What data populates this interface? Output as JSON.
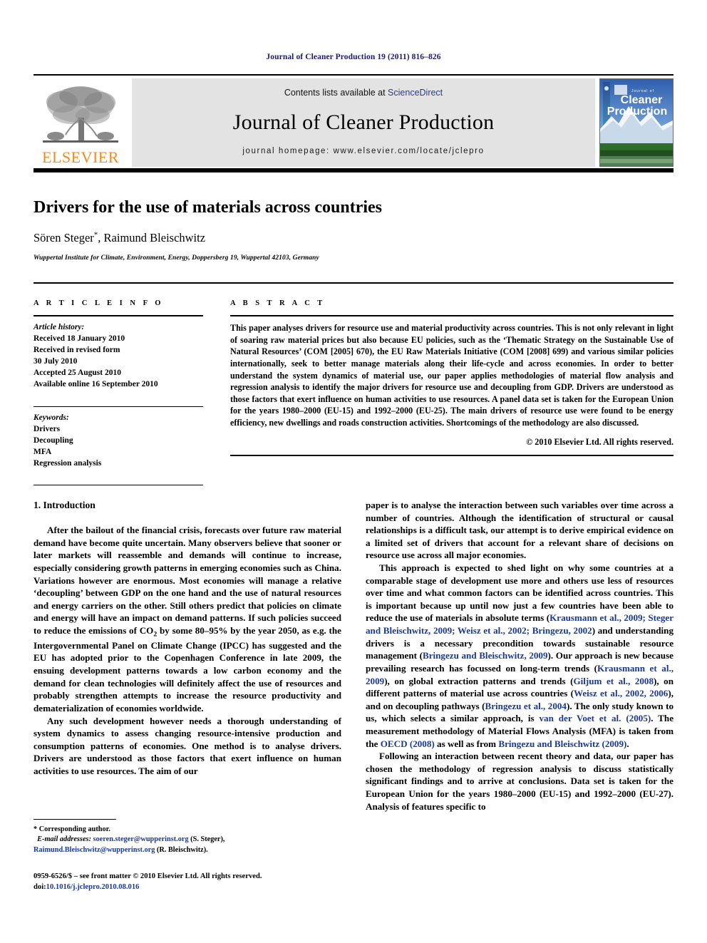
{
  "running_head": "Journal of Cleaner Production 19 (2011) 816–826",
  "masthead": {
    "publisher_name": "ELSEVIER",
    "contents_prefix": "Contents lists available at ",
    "sciencedirect": "ScienceDirect",
    "journal_title": "Journal of Cleaner Production",
    "homepage": "journal homepage: www.elsevier.com/locate/jclepro",
    "cover": {
      "line1": "Journal of",
      "line2": "Cleaner",
      "line3": "Production"
    }
  },
  "article": {
    "title": "Drivers for the use of materials across countries",
    "authors": "Sören Steger, Raimund Bleischwitz",
    "author_marker": "*",
    "affiliation": "Wuppertal Institute for Climate, Environment, Energy, Doppersberg 19, Wuppertal 42103, Germany"
  },
  "article_info": {
    "heading": "A R T I C L E   I N F O",
    "history_label": "Article history:",
    "history": [
      "Received 18 January 2010",
      "Received in revised form",
      "30 July 2010",
      "Accepted 25 August 2010",
      "Available online 16 September 2010"
    ],
    "keywords_label": "Keywords:",
    "keywords": [
      "Drivers",
      "Decoupling",
      "MFA",
      "Regression analysis"
    ]
  },
  "abstract": {
    "heading": "A B S T R A C T",
    "text": "This paper analyses drivers for resource use and material productivity across countries. This is not only relevant in light of soaring raw material prices but also because EU policies, such as the ‘Thematic Strategy on the Sustainable Use of Natural Resources’ (COM [2005] 670), the EU Raw Materials Initiative (COM [2008] 699) and various similar policies internationally, seek to better manage materials along their life-cycle and across economies. In order to better understand the system dynamics of material use, our paper applies methodologies of material flow analysis and regression analysis to identify the major drivers for resource use and decoupling from GDP. Drivers are understood as those factors that exert influence on human activities to use resources. A panel data set is taken for the European Union for the years 1980–2000 (EU-15) and 1992–2000 (EU-25). The main drivers of resource use were found to be energy efficiency, new dwellings and roads construction activities. Shortcomings of the methodology are also discussed.",
    "copyright": "© 2010 Elsevier Ltd. All rights reserved."
  },
  "body": {
    "section_number_title": "1. Introduction",
    "left_paragraphs": [
      "After the bailout of the financial crisis, forecasts over future raw material demand have become quite uncertain. Many observers believe that sooner or later markets will reassemble and demands will continue to increase, especially considering growth patterns in emerging economies such as China. Variations however are enormous. Most economies will manage a relative ‘decoupling’ between GDP on the one hand and the use of natural resources and energy carriers on the other. Still others predict that policies on climate and energy will have an impact on demand patterns. If such policies succeed to reduce the emissions of CO2 by some 80–95% by the year 2050, as e.g. the Intergovernmental Panel on Climate Change (IPCC) has suggested and the EU has adopted prior to the Copenhagen Conference in late 2009, the ensuing development patterns towards a low carbon economy and the demand for clean technologies will definitely affect the use of resources and probably strengthen attempts to increase the resource productivity and dematerialization of economies worldwide.",
      "Any such development however needs a thorough understanding of system dynamics to assess changing resource-intensive production and consumption patterns of economies. One method is to analyse drivers. Drivers are understood as those factors that exert influence on human activities to use resources. The aim of our"
    ],
    "right_paragraphs": [
      "paper is to analyse the interaction between such variables over time across a number of countries. Although the identification of structural or causal relationships is a difficult task, our attempt is to derive empirical evidence on a limited set of drivers that account for a relevant share of decisions on resource use across all major economies.",
      "This approach is expected to shed light on why some countries at a comparable stage of development use more and others use less of resources over time and what common factors can be identified across countries. This is important because up until now just a few countries have been able to reduce the use of materials in absolute terms (Krausmann et al., 2009; Steger and Bleischwitz, 2009; Weisz et al., 2002; Bringezu, 2002) and understanding drivers is a necessary precondition towards sustainable resource management (Bringezu and Bleischwitz, 2009). Our approach is new because prevailing research has focussed on long-term trends (Krausmann et al., 2009), on global extraction patterns and trends (Giljum et al., 2008), on different patterns of material use across countries (Weisz et al., 2002, 2006), and on decoupling pathways (Bringezu et al., 2004). The only study known to us, which selects a similar approach, is van der Voet et al. (2005). The measurement methodology of Material Flows Analysis (MFA) is taken from the OECD (2008) as well as from Bringezu and Bleischwitz (2009).",
      "Following an interaction between recent theory and data, our paper has chosen the methodology of regression analysis to discuss statistically significant findings and to arrive at conclusions. Data set is taken for the European Union for the years 1980–2000 (EU-15) and 1992–2000 (EU-27). Analysis of features specific to"
    ]
  },
  "footnote": {
    "corresponding": "* Corresponding author.",
    "email_label": "E-mail addresses:",
    "email_1": "soeren.steger@wupperinst.org",
    "email_1_who": " (S. Steger), ",
    "email_2": "Raimund.Bleischwitz@wupperinst.org",
    "email_2_who": " (R. Bleischwitz)."
  },
  "imprint": {
    "issn_line": "0959-6526/$ – see front matter © 2010 Elsevier Ltd. All rights reserved.",
    "doi_label": "doi:",
    "doi_value": "10.1016/j.jclepro.2010.08.016"
  },
  "colors": {
    "running_head": "#1a1a6e",
    "elsevier_orange": "#f08c1e",
    "citation_blue": "#1b3a8f",
    "band_gray": "#e3e3e3"
  }
}
